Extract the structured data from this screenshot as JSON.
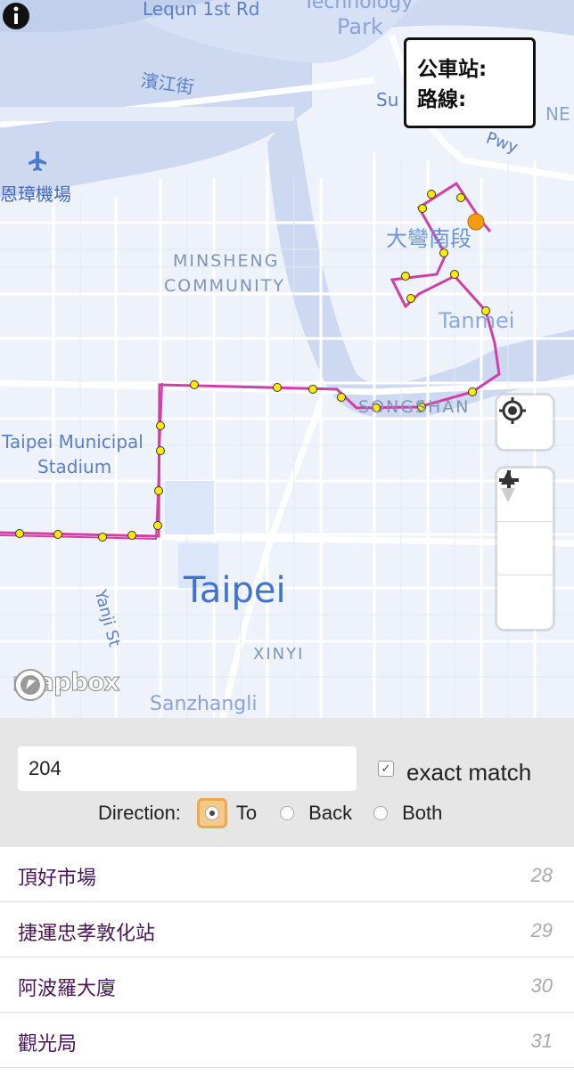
{
  "map": {
    "labels": {
      "lequn_rd": "Lequn 1st Rd",
      "technology": "Technology",
      "park": "Park",
      "binjiang": "濱江街",
      "airport": "恩璋機場",
      "minsheng": "MINSHENG",
      "community": "COMMUNITY",
      "dawan": "大彎南段",
      "tanmei": "Tanmei",
      "songshan": "SONGSHAN",
      "stadium1": "Taipei Municipal",
      "stadium2": "Stadium",
      "taipei": "Taipei",
      "xinyi": "XINYI",
      "yanji": "Yanji St",
      "sanzhangli": "Sanzhangli",
      "su": "Su",
      "pwy": "Pwy",
      "ne": "NE"
    },
    "route_color": "#d13fa6",
    "stop_color": "#ffeb00",
    "current_stop_color": "#f39c12",
    "logo_text": "mapbox",
    "icons": [
      "airport-icon",
      "geolocate-icon",
      "zoom-in-icon",
      "zoom-out-icon",
      "compass-icon",
      "info-icon"
    ]
  },
  "infobox": {
    "stop_label": "公車站:",
    "route_label": "路線:"
  },
  "controls": {
    "route_value": "204",
    "exact_match_label": "exact match",
    "exact_match_checked": true,
    "direction_label": "Direction:",
    "options": [
      "To",
      "Back",
      "Both"
    ],
    "selected": "To"
  },
  "stops": [
    {
      "name": "頂好市場",
      "num": "28"
    },
    {
      "name": "捷運忠孝敦化站",
      "num": "29"
    },
    {
      "name": "阿波羅大廈",
      "num": "30"
    },
    {
      "name": "觀光局",
      "num": "31"
    }
  ]
}
